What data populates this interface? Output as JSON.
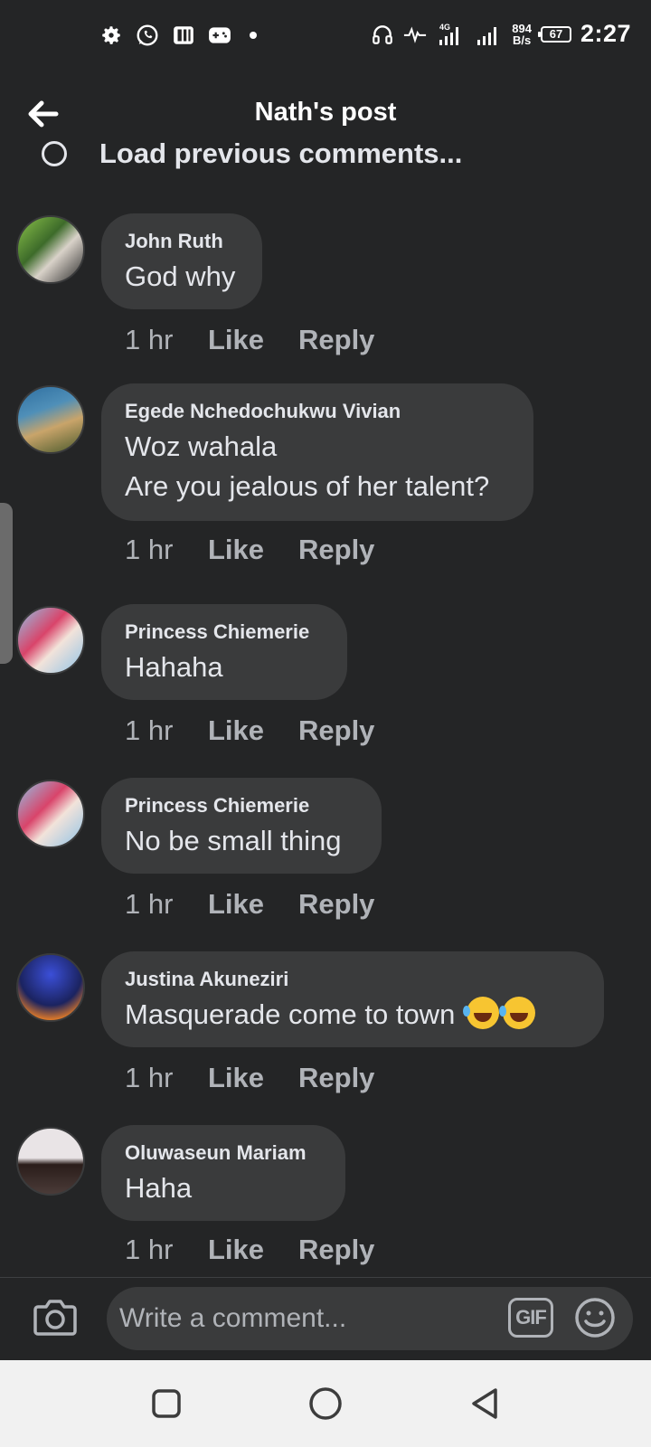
{
  "status_bar": {
    "time": "2:27",
    "battery": "67",
    "net_speed_value": "894",
    "net_speed_unit": "B/s",
    "network_type": "4G",
    "left_icons": [
      "gear-icon",
      "whatsapp-icon",
      "app-icon",
      "gamepad-icon"
    ],
    "right_icons": [
      "headphones-icon",
      "activity-icon",
      "signal-icon",
      "signal-icon-2",
      "battery-icon"
    ]
  },
  "header": {
    "title": "Nath's post"
  },
  "load_previous": {
    "label": "Load previous comments..."
  },
  "comments": [
    {
      "author": "John Ruth",
      "lines": [
        "God why"
      ],
      "time": "1 hr",
      "like": "Like",
      "reply": "Reply",
      "avatar_color": "#5a7d3c"
    },
    {
      "author": "Egede Nchedochukwu Vivian",
      "lines": [
        "Woz wahala",
        "Are you jealous of her talent?"
      ],
      "time": "1 hr",
      "like": "Like",
      "reply": "Reply",
      "avatar_color": "#3a6f8f"
    },
    {
      "author": "Princess Chiemerie",
      "lines": [
        "Hahaha"
      ],
      "time": "1 hr",
      "like": "Like",
      "reply": "Reply",
      "avatar_color": "#a84a5a"
    },
    {
      "author": "Princess Chiemerie",
      "lines": [
        "No be small thing"
      ],
      "time": "1 hr",
      "like": "Like",
      "reply": "Reply",
      "avatar_color": "#a84a5a"
    },
    {
      "author": "Justina Akuneziri",
      "lines": [
        "Masquerade come to town"
      ],
      "emoji": [
        "rolling-on-floor-laughing-emoji",
        "rolling-on-floor-laughing-emoji"
      ],
      "time": "1 hr",
      "like": "Like",
      "reply": "Reply",
      "avatar_color": "#2d3a8c"
    },
    {
      "author": "Oluwaseun Mariam",
      "lines": [
        "Haha"
      ],
      "time": "1 hr",
      "like": "Like",
      "reply": "Reply",
      "avatar_color": "#c9b7b0"
    }
  ],
  "composer": {
    "placeholder": "Write a comment...",
    "gif_label": "GIF"
  },
  "navbar": {
    "icons": [
      "recent-apps-icon",
      "home-icon",
      "back-nav-icon"
    ]
  }
}
